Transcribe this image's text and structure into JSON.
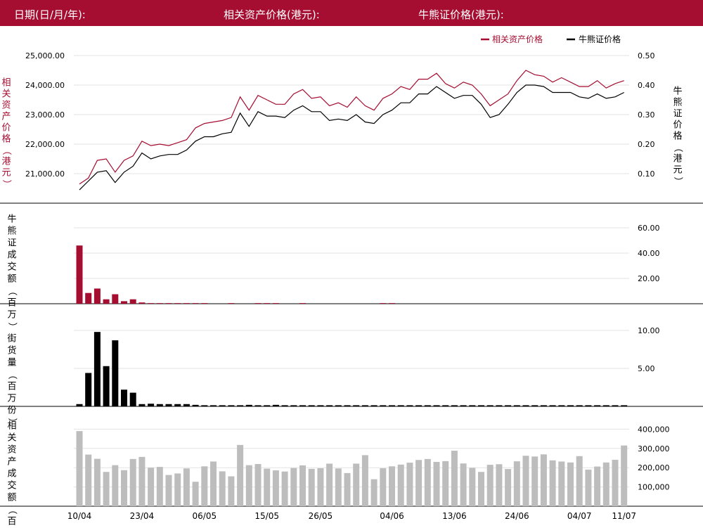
{
  "header": {
    "date_label": "日期(日/月/年):",
    "underlying_label": "相关资产价格(港元):",
    "cbbc_label": "牛熊证价格(港元):"
  },
  "colors": {
    "header_bg": "#a50d31",
    "underlying": "#a50d31",
    "cbbc": "#000000",
    "asset_turnover": "#bdbdbd"
  },
  "chart_data": [
    {
      "type": "line",
      "legend": [
        "相关资产价格",
        "牛熊证价格"
      ],
      "legend_position": "top-right",
      "ylabel_left": "相关资产价格（港元）",
      "ylabel_right": "牛熊证价格（港元）",
      "yticks_left": [
        "21,000.00",
        "22,000.00",
        "23,000.00",
        "24,000.00",
        "25,000.00"
      ],
      "yticks_right": [
        "0.10",
        "0.20",
        "0.30",
        "0.40",
        "0.50"
      ],
      "ylim_left": [
        20000,
        25000
      ],
      "ylim_right": [
        0.0,
        0.5
      ],
      "series": [
        {
          "name": "相关资产价格",
          "axis": "left",
          "values": [
            20650,
            20850,
            21450,
            21500,
            21050,
            21450,
            21600,
            22100,
            21950,
            22000,
            21950,
            22050,
            22150,
            22550,
            22700,
            22750,
            22800,
            22900,
            23600,
            23150,
            23650,
            23500,
            23350,
            23350,
            23700,
            23850,
            23550,
            23600,
            23300,
            23400,
            23250,
            23600,
            23300,
            23150,
            23550,
            23700,
            23950,
            23850,
            24200,
            24200,
            24400,
            24050,
            23900,
            24100,
            24000,
            23700,
            23300,
            23500,
            23700,
            24150,
            24500,
            24350,
            24300,
            24100,
            24250,
            24100,
            23950,
            23950,
            24150,
            23900,
            24050,
            24150
          ]
        },
        {
          "name": "牛熊证价格",
          "axis": "right",
          "values": [
            0.045,
            0.075,
            0.105,
            0.11,
            0.07,
            0.105,
            0.125,
            0.17,
            0.15,
            0.16,
            0.165,
            0.165,
            0.18,
            0.21,
            0.225,
            0.225,
            0.235,
            0.24,
            0.305,
            0.26,
            0.31,
            0.295,
            0.295,
            0.29,
            0.315,
            0.33,
            0.31,
            0.31,
            0.28,
            0.285,
            0.28,
            0.3,
            0.275,
            0.27,
            0.3,
            0.315,
            0.34,
            0.34,
            0.37,
            0.37,
            0.395,
            0.375,
            0.355,
            0.365,
            0.365,
            0.335,
            0.29,
            0.3,
            0.335,
            0.375,
            0.4,
            0.4,
            0.395,
            0.375,
            0.375,
            0.375,
            0.36,
            0.355,
            0.37,
            0.355,
            0.36,
            0.375
          ]
        }
      ]
    },
    {
      "type": "bar",
      "ylabel": "牛熊证成交额（百万）",
      "yticks": [
        "20.00",
        "40.00",
        "60.00"
      ],
      "ylim": [
        0,
        60
      ],
      "values": [
        46.0,
        8.5,
        12.0,
        3.5,
        7.5,
        2.0,
        3.5,
        1.0,
        0.5,
        0.5,
        0.5,
        0.5,
        0.5,
        0.5,
        0.5,
        0,
        0,
        0.5,
        0,
        0,
        0.5,
        0.5,
        0.5,
        0,
        0,
        0.5,
        0,
        0,
        0,
        0,
        0,
        0,
        0,
        0,
        0.5,
        0.5,
        0,
        0,
        0,
        0,
        0,
        0,
        0,
        0,
        0,
        0,
        0,
        0,
        0,
        0,
        0,
        0,
        0,
        0,
        0,
        0,
        0,
        0,
        0,
        0,
        0,
        0
      ]
    },
    {
      "type": "bar",
      "ylabel": "街货量（百万份）",
      "yticks": [
        "5.00",
        "10.00"
      ],
      "ylim": [
        0,
        10
      ],
      "values": [
        0.3,
        4.4,
        9.8,
        5.3,
        8.7,
        2.2,
        1.8,
        0.3,
        0.35,
        0.3,
        0.3,
        0.3,
        0.3,
        0.2,
        0.15,
        0.15,
        0.15,
        0.15,
        0.15,
        0.2,
        0.15,
        0.15,
        0.2,
        0.15,
        0.15,
        0.15,
        0.15,
        0.15,
        0.15,
        0.15,
        0.15,
        0.15,
        0.15,
        0.15,
        0.15,
        0.15,
        0.15,
        0.15,
        0.15,
        0.15,
        0.15,
        0.15,
        0.15,
        0.15,
        0.15,
        0.15,
        0.15,
        0.15,
        0.15,
        0.15,
        0.15,
        0.15,
        0.15,
        0.15,
        0.15,
        0.15,
        0.15,
        0.15,
        0.15,
        0.15,
        0.15,
        0.15
      ]
    },
    {
      "type": "bar",
      "ylabel": "相关资产成交额（百万）",
      "yticks": [
        "100,000",
        "200,000",
        "300,000",
        "400,000"
      ],
      "ylim": [
        0,
        400000
      ],
      "values": [
        390000,
        268000,
        246000,
        178000,
        213000,
        187000,
        245000,
        256000,
        200000,
        204000,
        162000,
        170000,
        196000,
        127000,
        207000,
        232000,
        181000,
        155000,
        318000,
        213000,
        219000,
        195000,
        186000,
        180000,
        198000,
        212000,
        194000,
        197000,
        221000,
        196000,
        172000,
        221000,
        265000,
        140000,
        197000,
        207000,
        216000,
        226000,
        240000,
        245000,
        230000,
        234000,
        288000,
        222000,
        199000,
        178000,
        215000,
        218000,
        193000,
        233000,
        262000,
        258000,
        269000,
        238000,
        232000,
        227000,
        260000,
        190000,
        206000,
        227000,
        241000,
        315000
      ]
    }
  ],
  "x_axis": {
    "tick_labels": [
      "10/04",
      "23/04",
      "06/05",
      "15/05",
      "26/05",
      "04/06",
      "13/06",
      "24/06",
      "04/07",
      "11/07"
    ]
  }
}
